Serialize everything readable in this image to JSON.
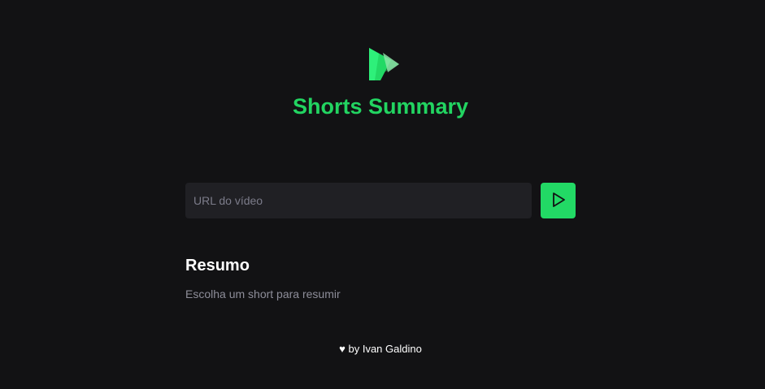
{
  "app": {
    "title": "Shorts Summary",
    "logo_icon": "play-icon",
    "brand_color": "#22d461"
  },
  "form": {
    "url_placeholder": "URL do vídeo",
    "url_value": "",
    "submit_icon": "play-outline-icon",
    "submit_color": "#22d965"
  },
  "summary": {
    "heading": "Resumo",
    "text": "Escolha um short para resumir"
  },
  "footer": {
    "heart": "♥",
    "text": "by Ivan Galdino"
  }
}
